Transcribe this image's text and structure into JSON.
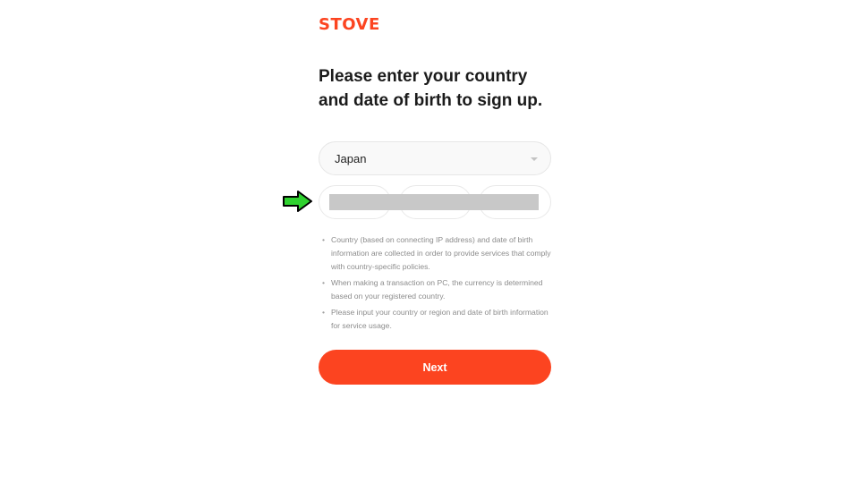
{
  "brand": {
    "logo_text": "STOVE",
    "accent_color": "#fc4420"
  },
  "heading": "Please enter your country and date of birth to sign up.",
  "country_select": {
    "value": "Japan",
    "icon": "chevron-down-icon"
  },
  "birth_date": {
    "fields": [
      "",
      "",
      ""
    ],
    "redacted": true
  },
  "annotation": {
    "icon": "green-arrow-icon",
    "color": "#22c122"
  },
  "notes": [
    "Country (based on connecting IP address) and date of birth information are collected in order to provide services that comply with country-specific policies.",
    "When making a transaction on PC, the currency is determined based on your registered country.",
    "Please input your country or region and date of birth information for service usage."
  ],
  "bullet_char": "•",
  "next_button": {
    "label": "Next"
  }
}
